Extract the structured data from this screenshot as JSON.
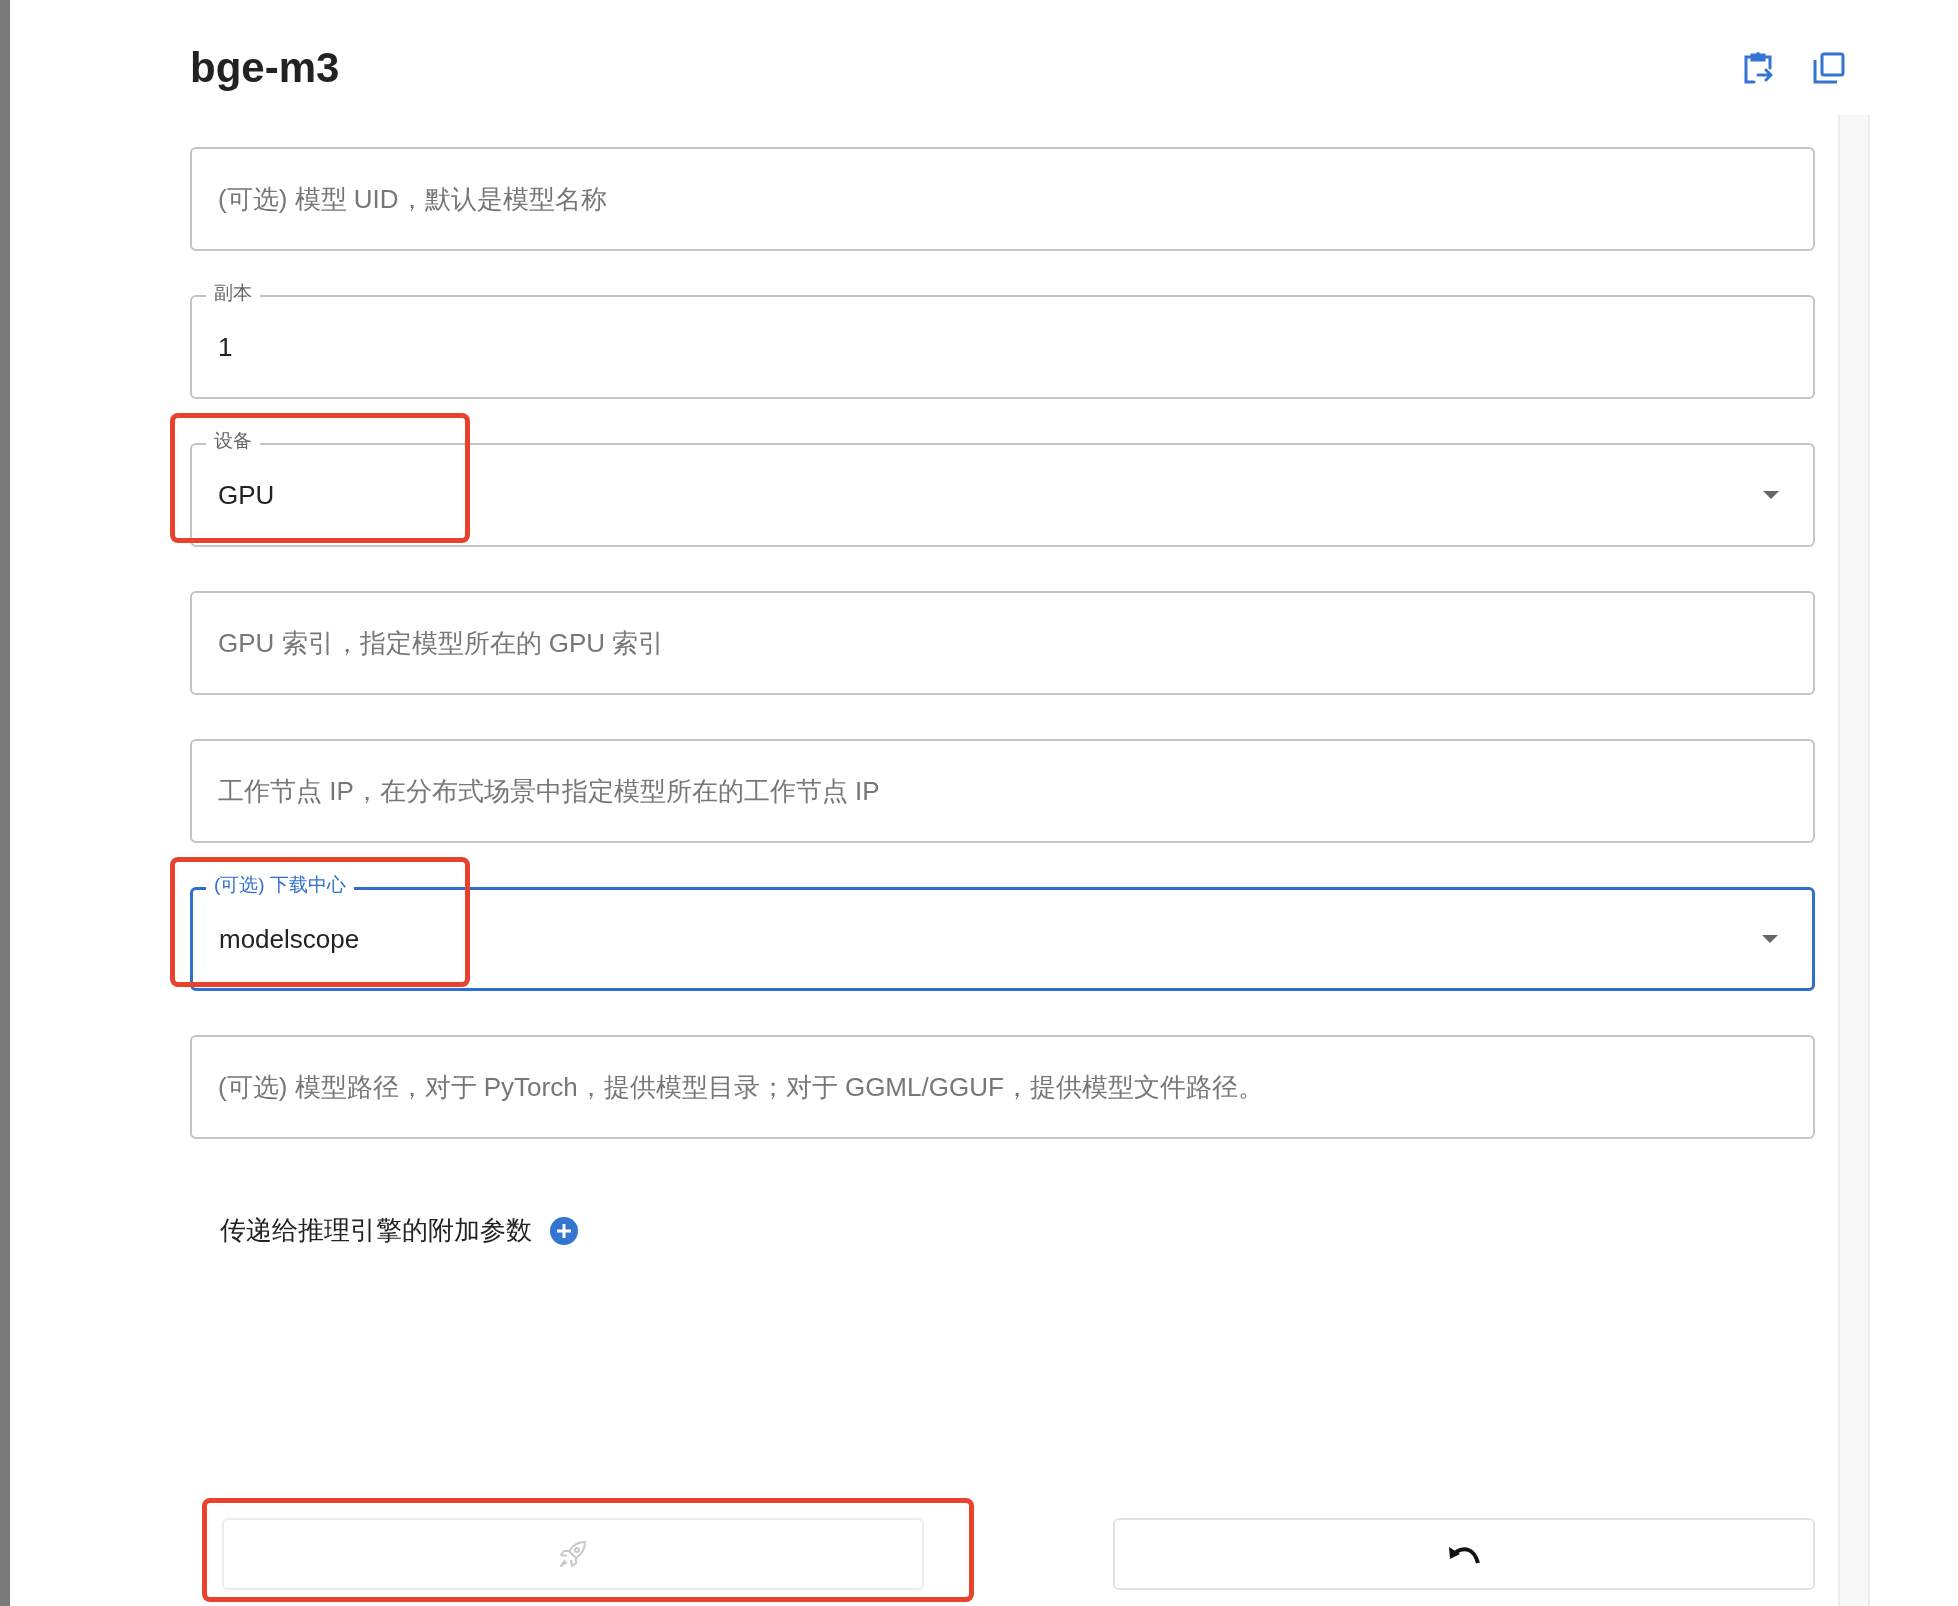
{
  "title": "bge-m3",
  "fields": [
    {
      "kind": "text",
      "placeholder": "(可选) 模型 UID，默认是模型名称",
      "focused": false,
      "highlighted": false
    },
    {
      "kind": "text",
      "label": "副本",
      "value": "1",
      "focused": false,
      "highlighted": false
    },
    {
      "kind": "select",
      "label": "设备",
      "value": "GPU",
      "focused": false,
      "highlighted": true
    },
    {
      "kind": "text",
      "placeholder": "GPU 索引，指定模型所在的 GPU 索引",
      "focused": false,
      "highlighted": false
    },
    {
      "kind": "text",
      "placeholder": "工作节点 IP，在分布式场景中指定模型所在的工作节点 IP",
      "focused": false,
      "highlighted": false
    },
    {
      "kind": "select",
      "label": "(可选) 下载中心",
      "value": "modelscope",
      "focused": true,
      "highlighted": true
    },
    {
      "kind": "text",
      "placeholder": "(可选) 模型路径，对于 PyTorch，提供模型目录；对于 GGML/GGUF，提供模型文件路径。",
      "focused": false,
      "highlighted": false
    }
  ],
  "extra_params": {
    "label": "传递给推理引擎的附加参数"
  },
  "buttons": [
    {
      "kind": "launch",
      "disabled": true,
      "highlighted": true
    },
    {
      "kind": "cancel",
      "disabled": false,
      "highlighted": false
    }
  ]
}
